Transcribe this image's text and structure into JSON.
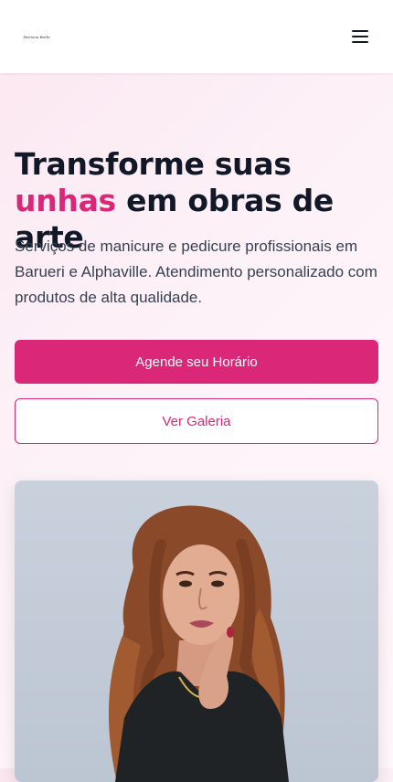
{
  "header": {
    "logo_text": "Mariana Barbi",
    "menu_icon": "hamburger-menu-icon"
  },
  "hero": {
    "title_part1": "Transforme suas ",
    "title_accent": "unhas",
    "title_part2": " em obras de arte",
    "subtitle": "Serviços de manicure e pedicure profissionais em Barueri e Alphaville. Atendimento personalizado com produtos de alta qualidade.",
    "primary_button": "Agende seu Horário",
    "secondary_button": "Ver Galeria",
    "image_icon": "woman-portrait-photo"
  },
  "colors": {
    "accent": "#db2777",
    "heading": "#111827",
    "background": "#fdf2f8"
  }
}
